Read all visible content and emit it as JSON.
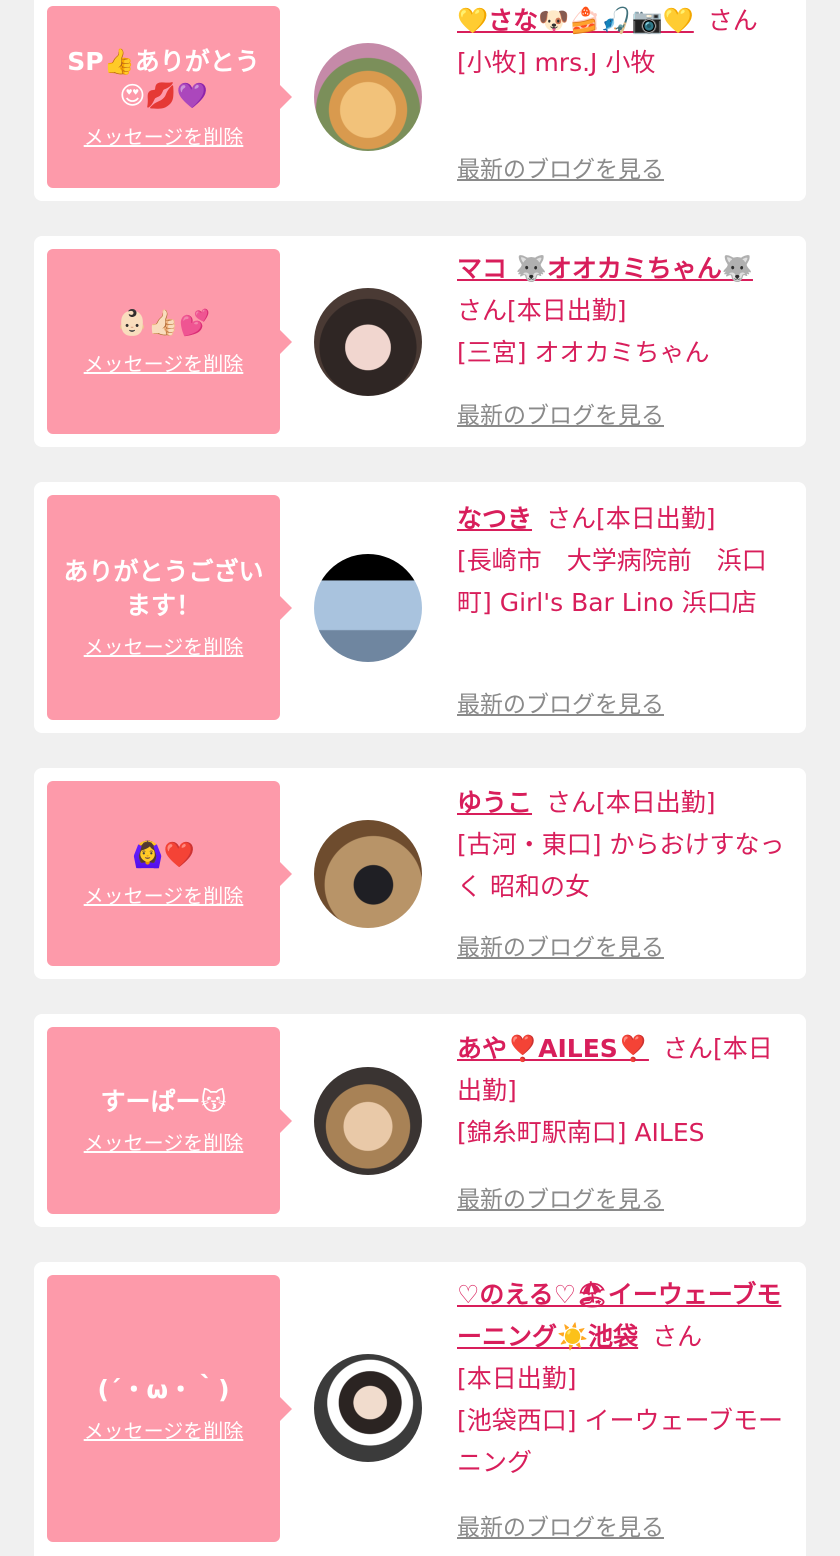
{
  "delete_label": "メッセージを削除",
  "blog_label": "最新のブログを見る",
  "san": "さん",
  "cards": [
    {
      "message": "SP👍ありがとう😍💋💜",
      "name": "💛さな🐶🍰🎣📷💛",
      "status": "",
      "shop": "[小牧] mrs.J 小牧"
    },
    {
      "message": "👶🏻👍🏻💕",
      "name": "マコ 🐺オオカミちゃん🐺",
      "status": "[本日出勤]",
      "shop": "[三宮] オオカミちゃん"
    },
    {
      "message": "ありがとうございます！",
      "name": "なつき",
      "status": "[本日出勤]",
      "shop": "[長崎市　大学病院前　浜口町] Girl's Bar Lino 浜口店"
    },
    {
      "message": "🙆‍♀️❤️",
      "name": "ゆうこ",
      "status": "[本日出勤]",
      "shop": "[古河・東口] からおけすなっく 昭和の女"
    },
    {
      "message": "すーぱー😽",
      "name": "あや❣️AILES❣️",
      "status": "[本日出勤]",
      "shop": "[錦糸町駅南口] AILES"
    },
    {
      "message": "(´・ω・｀)",
      "name": "♡のえる♡🏖イーウェーブモーニング☀️池袋",
      "status": "[本日出勤]",
      "shop": "[池袋西口] イーウェーブモーニング"
    }
  ]
}
